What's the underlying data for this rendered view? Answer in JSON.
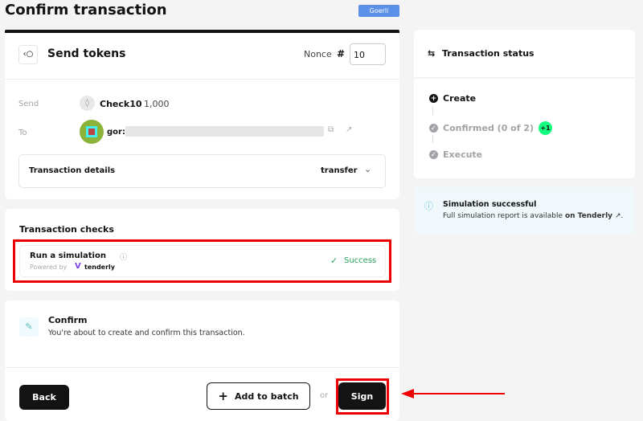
{
  "page_title": "Confirm transaction",
  "network_badge": "Goerli",
  "send_tokens": {
    "title": "Send tokens",
    "nonce_label": "Nonce",
    "nonce_hash": "#",
    "nonce_value": "10"
  },
  "send_row": {
    "label": "Send",
    "token": "Check10",
    "amount": "1,000"
  },
  "to_row": {
    "label": "To",
    "address_prefix": "gor:"
  },
  "details": {
    "label": "Transaction details",
    "method": "transfer"
  },
  "checks": {
    "title": "Transaction checks",
    "simulation_label": "Run a simulation",
    "powered_by": "Powered by",
    "provider": "tenderly",
    "status": "Success"
  },
  "confirm": {
    "title": "Confirm",
    "description": "You're about to create and confirm this transaction."
  },
  "actions": {
    "back": "Back",
    "add_to_batch": "Add to batch",
    "or": "or",
    "sign": "Sign"
  },
  "status": {
    "title": "Transaction status",
    "steps": [
      {
        "label": "Create"
      },
      {
        "label": "Confirmed (0 of 2)",
        "badge": "+1"
      },
      {
        "label": "Execute"
      }
    ]
  },
  "simulation_notice": {
    "title": "Simulation successful",
    "text": "Full simulation report is available",
    "link": "on Tenderly",
    "suffix": "."
  },
  "colors": {
    "accent": "#12ff80",
    "success": "#28a25a",
    "highlight": "#e00000",
    "badge": "#5c8fe8"
  }
}
